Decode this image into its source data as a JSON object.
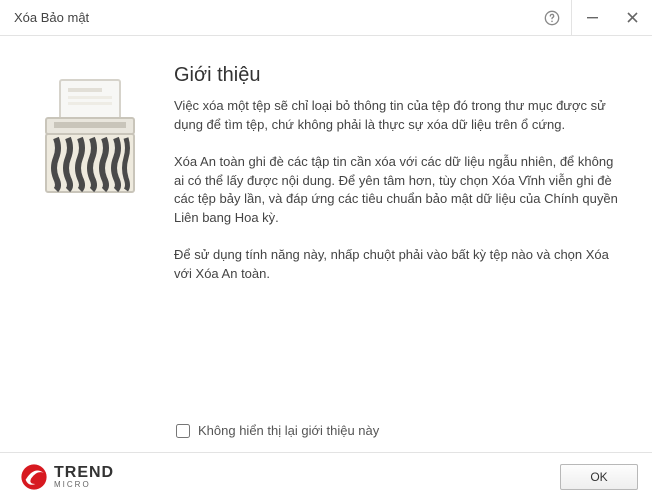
{
  "window": {
    "title": "Xóa Bảo mật"
  },
  "intro": {
    "heading": "Giới thiệu",
    "p1": "Việc xóa một tệp sẽ chỉ loại bỏ thông tin của tệp đó trong thư mục được sử dụng để tìm tệp, chứ không phải là thực sự xóa dữ liệu trên ổ cứng.",
    "p2": "Xóa An toàn ghi đè các tập tin cần xóa với các dữ liệu ngẫu nhiên, để không ai có thể lấy được nội dung. Để yên tâm hơn, tùy chọn Xóa Vĩnh viễn ghi đè các tệp bảy lần, và đáp ứng các tiêu chuẩn bảo mật dữ liệu của Chính quyền Liên bang Hoa kỳ.",
    "p3": "Để sử dụng tính năng này, nhấp chuột phải vào bất kỳ tệp nào và chọn Xóa với Xóa An toàn."
  },
  "checkbox": {
    "label": "Không hiển thị lại giới thiệu này"
  },
  "brand": {
    "line1": "TREND",
    "line2": "MICRO"
  },
  "buttons": {
    "ok": "OK"
  }
}
